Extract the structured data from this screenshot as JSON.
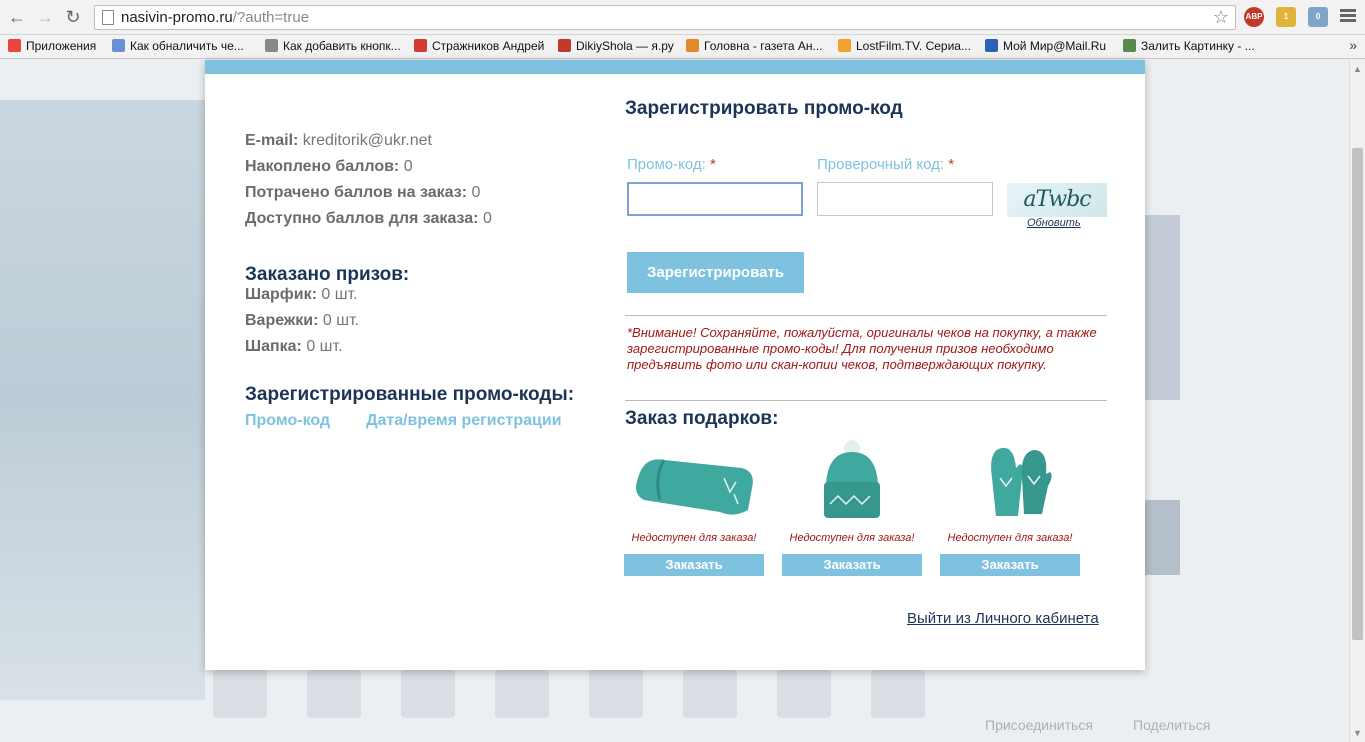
{
  "browser": {
    "url_host": "nasivin-promo.ru",
    "url_rest": "/?auth=true",
    "extensions": [
      "ABP",
      "1",
      "0"
    ],
    "bookmarks": [
      {
        "label": "Приложения",
        "color": "#e8453c"
      },
      {
        "label": "Как обналичить че...",
        "color": "#6b8fd6"
      },
      {
        "label": "Как добавить кнопк...",
        "color": "#888888"
      },
      {
        "label": "Стражников Андрей",
        "color": "#d43b2e"
      },
      {
        "label": "DikiyShola — я.ру",
        "color": "#c0392b"
      },
      {
        "label": "Головна - газета Ан...",
        "color": "#e08a2c"
      },
      {
        "label": "LostFilm.TV. Сериа...",
        "color": "#f2a12b"
      },
      {
        "label": "Мой Мир@Mail.Ru",
        "color": "#2b62b8"
      },
      {
        "label": "Залить Картинку - ...",
        "color": "#5a8a4b"
      }
    ]
  },
  "background": {
    "footer_links": [
      "Присоединиться",
      "Поделиться"
    ]
  },
  "account": {
    "email_label": "E-mail:",
    "email_value": "kreditorik@ukr.net",
    "accumulated_label": "Накоплено баллов:",
    "accumulated_value": "0",
    "spent_label": "Потрачено баллов на заказ:",
    "spent_value": "0",
    "available_label": "Доступно баллов для заказа:",
    "available_value": "0"
  },
  "prizes": {
    "title": "Заказано призов:",
    "items": [
      {
        "label": "Шарфик:",
        "value": "0 шт."
      },
      {
        "label": "Варежки:",
        "value": "0 шт."
      },
      {
        "label": "Шапка:",
        "value": "0 шт."
      }
    ]
  },
  "codes": {
    "title": "Зарегистрированные промо-коды:",
    "col_code": "Промо-код",
    "col_date": "Дата/время регистрации"
  },
  "register": {
    "title": "Зарегистрировать промо-код",
    "promo_label": "Промо-код:",
    "check_label": "Проверочный код:",
    "required_mark": "*",
    "promo_value": "",
    "check_value": "",
    "captcha_text": "aTwbc",
    "refresh_label": "Обновить",
    "submit_label": "Зарегистрировать"
  },
  "warning": "*Внимание! Сохраняйте, пожалуйста, оригиналы чеков на покупку, а также зарегистрированные промо-коды! Для получения призов необходимо предъявить фото или скан-копии чеков, подтверждающих покупку.",
  "gifts": {
    "title": "Заказ подарков:",
    "accent_color": "#3fa9a0",
    "items": [
      {
        "status": "Недоступен для заказа!",
        "button": "Заказать"
      },
      {
        "status": "Недоступен для заказа!",
        "button": "Заказать"
      },
      {
        "status": "Недоступен для заказа!",
        "button": "Заказать"
      }
    ]
  },
  "logout_label": "Выйти из Личного кабинета"
}
